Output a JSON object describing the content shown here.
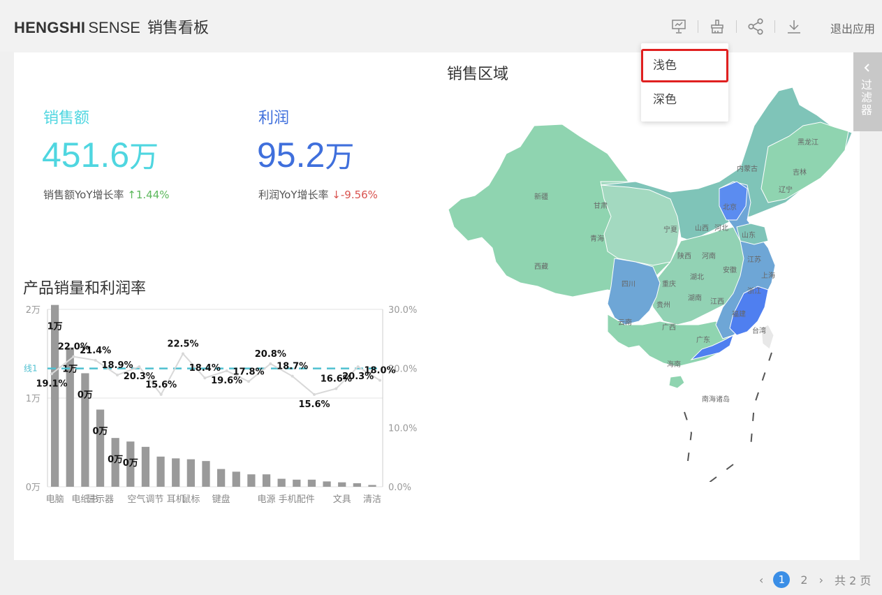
{
  "header": {
    "brand_bold": "HENGSHI",
    "brand_light": "SENSE",
    "title": "销售看板",
    "exit_label": "退出应用",
    "icons": [
      "presentation-icon",
      "theme-brush-icon",
      "share-icon",
      "download-icon"
    ]
  },
  "theme_menu": {
    "items": [
      "浅色",
      "深色"
    ],
    "selected": "浅色"
  },
  "filter_tab": {
    "label": "过滤器"
  },
  "kpis": [
    {
      "label": "销售额",
      "value": "451.6",
      "unit": "万",
      "sub_label": "销售额YoY增长率",
      "arrow": "↑",
      "change": "1.44%",
      "color": "#4fd6e0"
    },
    {
      "label": "利润",
      "value": "95.2",
      "unit": "万",
      "sub_label": "利润YoY增长率",
      "arrow": "↓",
      "change": "-9.56%",
      "color": "#3f6fdc"
    }
  ],
  "combo_chart": {
    "title": "产品销量和利润率",
    "y_left_ticks": [
      "2万",
      "1万",
      "0万"
    ],
    "y_right_ticks": [
      "30.0%",
      "20.0%",
      "10.0%",
      "0.0%"
    ],
    "x_labels": [
      "电脑",
      "电纸书",
      "显示器",
      "空气调节",
      "耳机",
      "鼠标",
      "键盘",
      "电源",
      "手机配件",
      "文具",
      "清洁"
    ],
    "bar_value_labels": [
      "1万",
      "1万",
      "0万",
      "0万",
      "0万",
      "0万"
    ],
    "ref_line_label": "线1",
    "rate_labels": [
      "19.1%",
      "22.0%",
      "21.4%",
      "18.9%",
      "20.3%",
      "15.6%",
      "22.5%",
      "18.4%",
      "19.6%",
      "17.8%",
      "20.8%",
      "18.7%",
      "15.6%",
      "16.6%",
      "20.3%",
      "18.0%"
    ]
  },
  "chart_data": {
    "type": "bar",
    "title": "产品销量和利润率",
    "categories": [
      "电脑",
      "",
      "电纸书",
      "显示器",
      "",
      "",
      "空气调节",
      "",
      "耳机",
      "鼠标",
      "",
      "键盘",
      "",
      "",
      "电源",
      "",
      "手机配件",
      "",
      "",
      "文具",
      "",
      "清洁"
    ],
    "series": [
      {
        "name": "",
        "type": "bar",
        "axis": "left",
        "values": [
          20500,
          15700,
          12800,
          8700,
          5500,
          5100,
          4500,
          3400,
          3200,
          3100,
          2900,
          2000,
          1700,
          1400,
          1400,
          900,
          800,
          800,
          600,
          500,
          400,
          200
        ]
      },
      {
        "name": "",
        "type": "line",
        "axis": "right",
        "values": [
          19.1,
          22.0,
          21.4,
          18.9,
          20.3,
          15.6,
          22.5,
          18.4,
          19.6,
          17.8,
          20.8,
          18.7,
          15.6,
          16.6,
          20.3,
          18.0
        ]
      }
    ],
    "reference_line": {
      "label": "线1",
      "value": 20.0
    },
    "ylim_left": [
      0,
      20000
    ],
    "ylim_right": [
      0,
      30
    ],
    "grid": true
  },
  "map": {
    "title": "销售区域",
    "region_labels": [
      "新疆",
      "西藏",
      "青海",
      "甘肃",
      "宁夏",
      "陕西",
      "四川",
      "云南",
      "贵州",
      "重庆",
      "广西",
      "广东",
      "海南",
      "湖南",
      "湖北",
      "河南",
      "山西",
      "河北",
      "北京",
      "内蒙古",
      "黑龙江",
      "吉林",
      "辽宁",
      "山东",
      "江苏",
      "上海",
      "浙江",
      "安徽",
      "江西",
      "福建",
      "台湾",
      "南海诸岛"
    ]
  },
  "pager": {
    "current": "1",
    "next": "2",
    "total_label": "共 2 页"
  }
}
